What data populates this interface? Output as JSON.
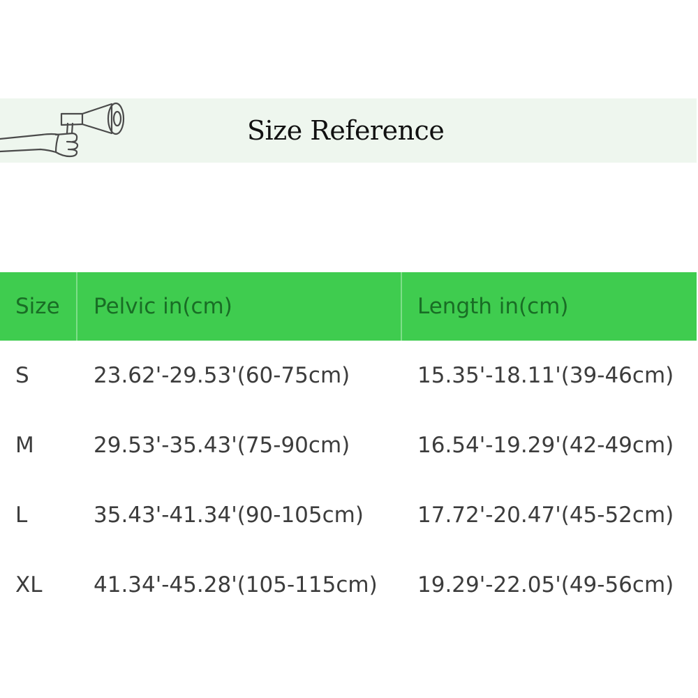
{
  "banner": {
    "title": "Size Reference",
    "icon": "megaphone-icon",
    "background": "#eef6ee"
  },
  "table": {
    "header_color": "#3fcc4f",
    "header_text_color": "#196d25",
    "headers": [
      "Size",
      "Pelvic  in(cm)",
      "Length in(cm)"
    ],
    "rows": [
      {
        "size": "S",
        "pelvic": "23.62'-29.53'(60-75cm)",
        "length": "15.35'-18.11'(39-46cm)"
      },
      {
        "size": "M",
        "pelvic": "29.53'-35.43'(75-90cm)",
        "length": "16.54'-19.29'(42-49cm)"
      },
      {
        "size": "L",
        "pelvic": "35.43'-41.34'(90-105cm)",
        "length": "17.72'-20.47'(45-52cm)"
      },
      {
        "size": "XL",
        "pelvic": "41.34'-45.28'(105-115cm)",
        "length": "19.29'-22.05'(49-56cm)"
      }
    ]
  }
}
